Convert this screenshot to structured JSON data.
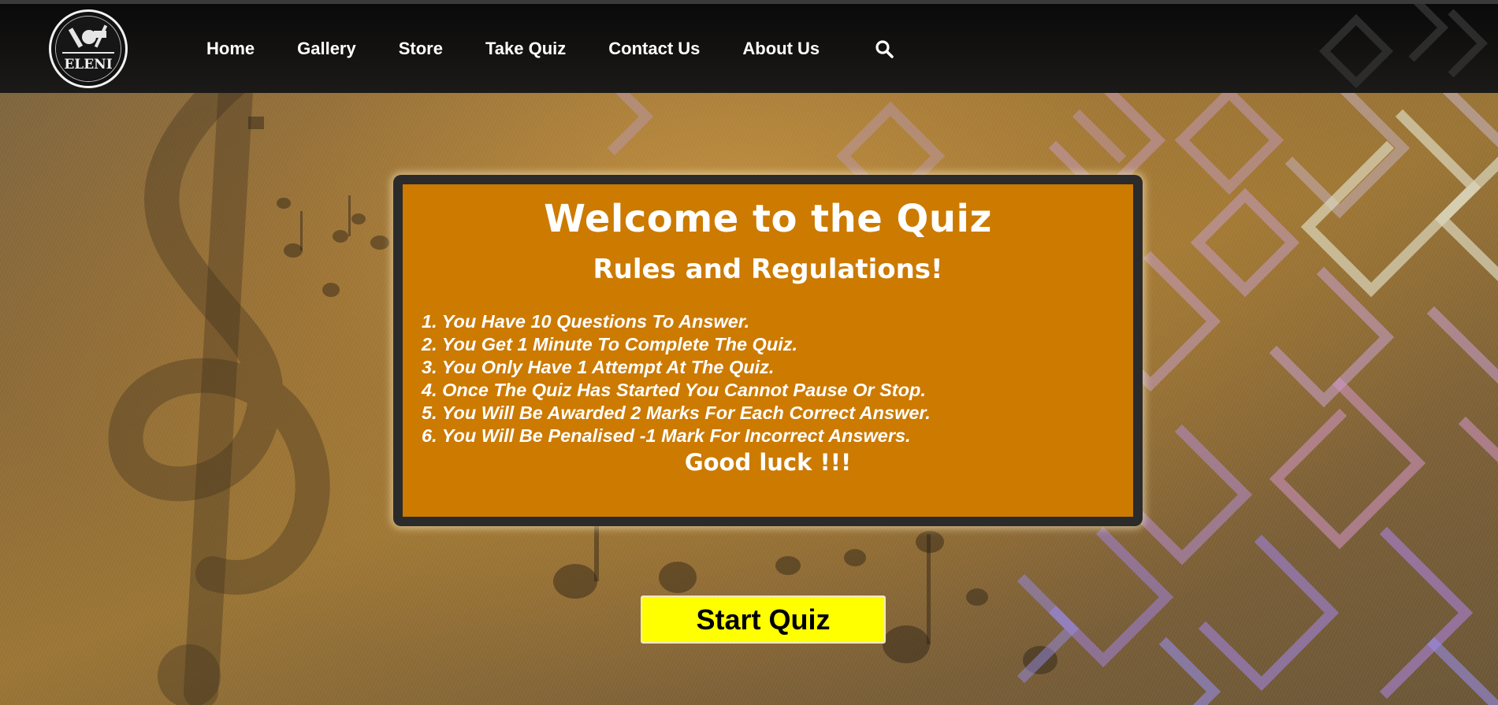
{
  "nav": {
    "logo_alt": "ELENI",
    "links": [
      "Home",
      "Gallery",
      "Store",
      "Take Quiz",
      "Contact Us",
      "About Us"
    ],
    "search_icon": "search-icon"
  },
  "card": {
    "title": "Welcome to the Quiz",
    "subtitle": "Rules and Regulations!",
    "rules": [
      "1. You Have 10 Questions To Answer.",
      "2. You Get 1 Minute To Complete The Quiz.",
      "3. You Only Have 1 Attempt At The Quiz.",
      "4. Once The Quiz Has Started You Cannot Pause Or Stop.",
      "5. You Will Be Awarded 2 Marks For Each Correct Answer.",
      "6. You Will Be Penalised -1 Mark For Incorrect Answers."
    ],
    "closing": "Good luck !!!"
  },
  "start_button": {
    "label": "Start Quiz"
  },
  "colors": {
    "navbar": "#0f0e0d",
    "card_frame": "#2b2b2b",
    "card_fill": "#cc7a00",
    "button": "#ffff00",
    "text_light": "#ffffff"
  }
}
